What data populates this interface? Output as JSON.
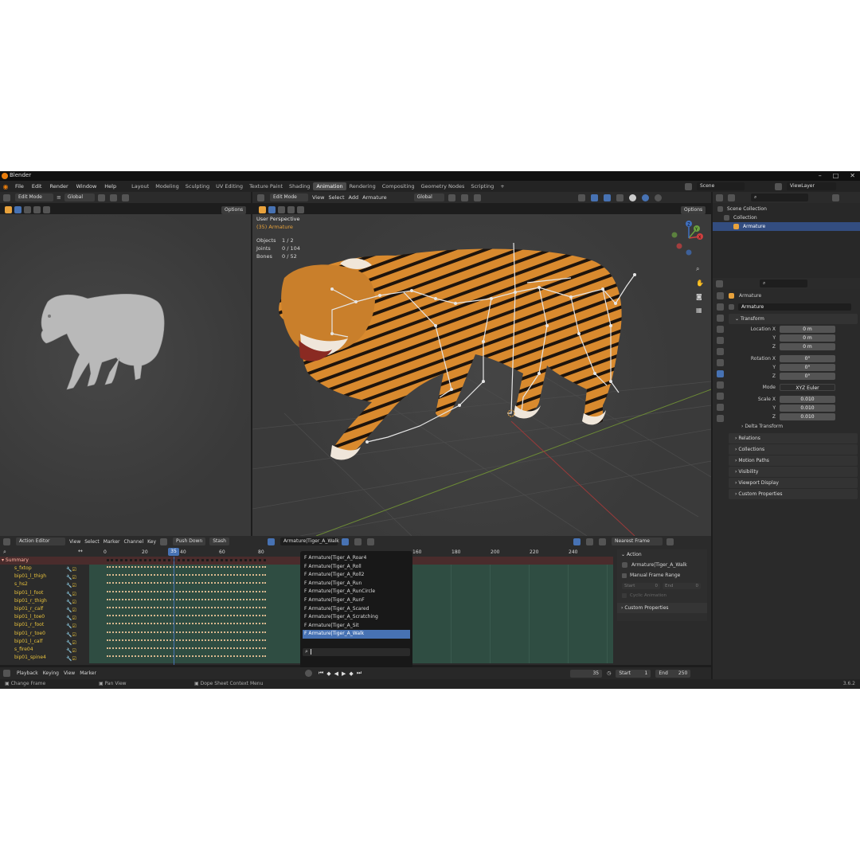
{
  "app": {
    "title": "Blender",
    "version": "3.6.2"
  },
  "menus": [
    "File",
    "Edit",
    "Render",
    "Window",
    "Help"
  ],
  "workspaces": [
    "Layout",
    "Modeling",
    "Sculpting",
    "UV Editing",
    "Texture Paint",
    "Shading",
    "Animation",
    "Rendering",
    "Compositing",
    "Geometry Nodes",
    "Scripting"
  ],
  "active_workspace": "Animation",
  "scene": {
    "name": "Scene",
    "view_layer": "ViewLayer"
  },
  "left_viewport": {
    "mode": "Edit Mode",
    "orientation": "Global",
    "options": "Options"
  },
  "main_viewport": {
    "mode": "Edit Mode",
    "menus": [
      "View",
      "Select",
      "Add",
      "Armature"
    ],
    "orientation": "Global",
    "options": "Options",
    "perspective": "User Perspective",
    "object": "(35) Armature",
    "stats": [
      {
        "label": "Objects",
        "value": "1 / 2"
      },
      {
        "label": "Joints",
        "value": "0 / 104"
      },
      {
        "label": "Bones",
        "value": "0 / 52"
      }
    ],
    "gizmo": {
      "x": "X",
      "y": "Y",
      "z": "Z"
    }
  },
  "outliner": {
    "root": "Scene Collection",
    "collection": "Collection",
    "object": "Armature"
  },
  "properties": {
    "object_name": "Armature",
    "data_name": "Armature",
    "transform_label": "Transform",
    "location_label": "Location X",
    "location": [
      "0 m",
      "0 m",
      "0 m"
    ],
    "rotation_label": "Rotation X",
    "rotation": [
      "0°",
      "0°",
      "0°"
    ],
    "mode_label": "Mode",
    "mode": "XYZ Euler",
    "scale_label": "Scale X",
    "scale": [
      "0.010",
      "0.010",
      "0.010"
    ],
    "axis_y": "Y",
    "axis_z": "Z",
    "delta": "Delta Transform",
    "panels": [
      "Relations",
      "Collections",
      "Motion Paths",
      "Visibility",
      "Viewport Display",
      "Custom Properties"
    ]
  },
  "dopesheet": {
    "editor": "Action Editor",
    "menus": [
      "View",
      "Select",
      "Marker",
      "Channel",
      "Key"
    ],
    "push_down": "Push Down",
    "stash": "Stash",
    "action": "Armature|Tiger_A_Walk",
    "snap": "Nearest Frame",
    "current_frame": "35",
    "ruler_left": [
      "0",
      "20",
      "40",
      "60",
      "80"
    ],
    "ruler_right": [
      "160",
      "180",
      "200",
      "220",
      "240"
    ],
    "summary": "Summary",
    "channels": [
      "s_fxtop",
      "bip01_l_thigh",
      "s_hs2",
      "bip01_l_foot",
      "bip01_r_thigh",
      "bip01_r_calf",
      "bip01_l_toe0",
      "bip01_r_foot",
      "bip01_r_toe0",
      "bip01_l_calf",
      "s_fire04",
      "bip01_spine4"
    ],
    "action_list": [
      "Armature|Tiger_A_Roar4",
      "Armature|Tiger_A_Roll",
      "Armature|Tiger_A_Roll2",
      "Armature|Tiger_A_Run",
      "Armature|Tiger_A_RunCircle",
      "Armature|Tiger_A_RunF",
      "Armature|Tiger_A_Scared",
      "Armature|Tiger_A_Scratching",
      "Armature|Tiger_A_Sit",
      "Armature|Tiger_A_Walk"
    ],
    "side_panel": {
      "title": "Action",
      "action": "Armature|Tiger_A_Walk",
      "manual_range": "Manual Frame Range",
      "start_label": "Start",
      "start": "0",
      "end_label": "End",
      "end": "0",
      "cyclic": "Cyclic Animation",
      "custom": "Custom Properties"
    }
  },
  "timeline": {
    "menus": [
      "Playback",
      "Keying",
      "View",
      "Marker"
    ],
    "frame": "35",
    "start_label": "Start",
    "start": "1",
    "end_label": "End",
    "end": "250"
  },
  "statusbar": [
    "Change Frame",
    "Pan View",
    "Dope Sheet Context Menu"
  ]
}
